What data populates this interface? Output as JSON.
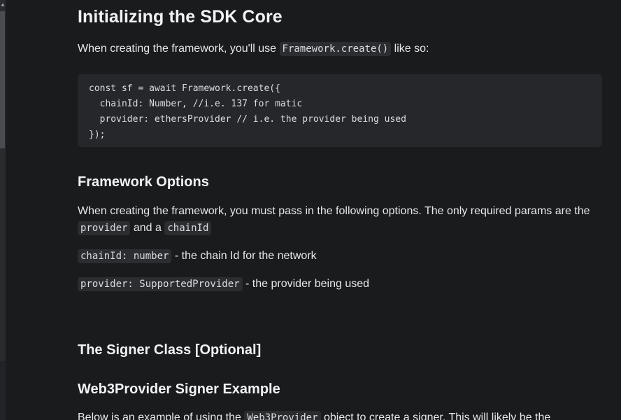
{
  "heading_main": "Initializing the SDK Core",
  "intro": {
    "before": "When creating the framework, you'll use ",
    "code": "Framework.create()",
    "after": " like so:"
  },
  "code_block": {
    "lines": [
      "const sf = await Framework.create({",
      "  chainId: Number, //i.e. 137 for matic",
      "  provider: ethersProvider // i.e. the provider being used",
      "});"
    ]
  },
  "framework_options": {
    "heading": "Framework Options",
    "para": {
      "text1": "When creating the framework, you must pass in the following options.  The only required params are the ",
      "code1": "provider",
      "text2": " and a ",
      "code2": "chainId"
    },
    "chain_line": {
      "code": "chainId: number",
      "text": " - the chain Id for the network"
    },
    "provider_line": {
      "code": "provider: SupportedProvider",
      "text": " - the provider being used"
    }
  },
  "signer": {
    "heading": "The Signer Class [Optional]",
    "subheading": "Web3Provider Signer Example",
    "para": {
      "text1": "Below is an example of using the ",
      "code": "Web3Provider",
      "text2": " object to create a signer. This will likely be the"
    }
  }
}
